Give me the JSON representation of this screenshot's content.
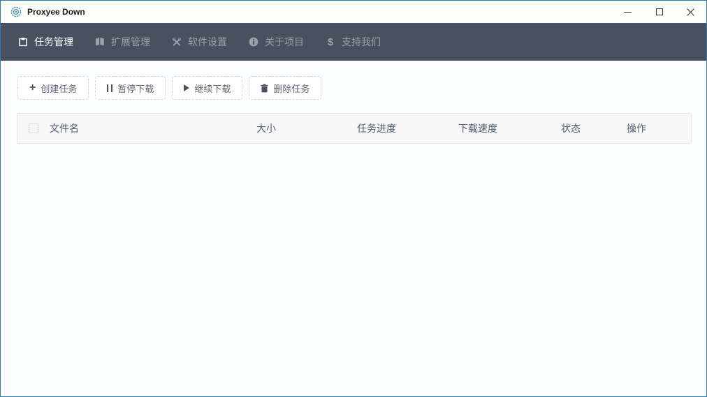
{
  "window": {
    "title": "Proxyee Down",
    "controls": {
      "minimize": "minimize",
      "maximize": "maximize",
      "close": "close"
    }
  },
  "nav": {
    "items": [
      {
        "label": "任务管理",
        "icon": "clipboard-icon",
        "active": true
      },
      {
        "label": "扩展管理",
        "icon": "book-icon",
        "active": false
      },
      {
        "label": "软件设置",
        "icon": "tools-icon",
        "active": false
      },
      {
        "label": "关于项目",
        "icon": "info-circle-icon",
        "active": false
      },
      {
        "label": "支持我们",
        "icon": "dollar-icon",
        "active": false
      }
    ]
  },
  "toolbar": {
    "buttons": [
      {
        "label": "创建任务",
        "icon": "plus-icon"
      },
      {
        "label": "暂停下载",
        "icon": "pause-icon"
      },
      {
        "label": "继续下载",
        "icon": "play-icon"
      },
      {
        "label": "删除任务",
        "icon": "trash-icon"
      }
    ]
  },
  "table": {
    "columns": [
      "文件名",
      "大小",
      "任务进度",
      "下载速度",
      "状态",
      "操作"
    ],
    "rows": []
  },
  "colors": {
    "window_border": "#2b7db5",
    "navbar_bg": "#495060",
    "nav_active_text": "#ffffff",
    "nav_inactive_text": "#9aa1ac",
    "content_bg": "#fbfcfd",
    "table_header_bg": "#f8f8f9",
    "table_header_text": "#515a6e",
    "button_border": "#d4d8dd",
    "logo_teal": "#3c93a8"
  }
}
